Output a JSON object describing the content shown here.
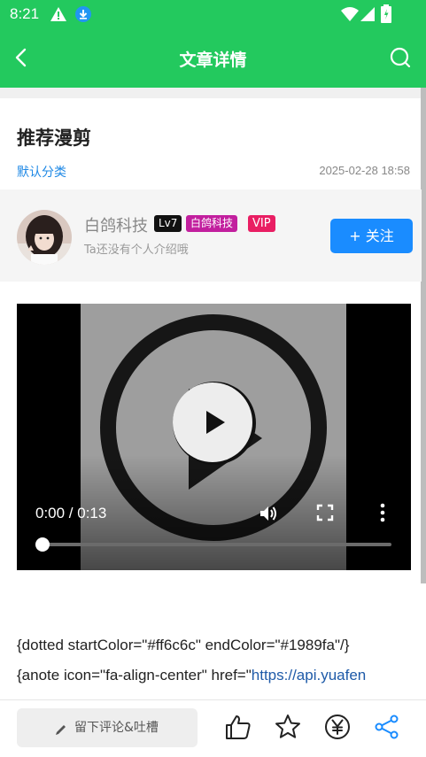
{
  "status_bar": {
    "time": "8:21"
  },
  "app_bar": {
    "title": "文章详情"
  },
  "article": {
    "title": "推荐漫剪",
    "category": "默认分类",
    "date": "2025-02-28 18:58"
  },
  "author": {
    "name": "白鸽科技",
    "level_badge": "Lv7",
    "org_badge": "白鸽科技",
    "vip_badge": "VIP",
    "bio": "Ta还没有个人介绍哦",
    "follow_label": "+ 关注"
  },
  "video": {
    "current_time": "0:00",
    "duration": "0:13",
    "time_display": "0:00 / 0:13",
    "progress": 0
  },
  "content": {
    "line1": "{dotted startColor=\"#ff6c6c\" endColor=\"#1989fa\"/}",
    "line2_prefix": "{anote icon=\"fa-align-center\" href=\"",
    "line2_link": "https://api.yuafen"
  },
  "bottom_bar": {
    "comment_placeholder": "留下评论&吐槽"
  },
  "colors": {
    "accent": "#23c95e",
    "link": "#1e88e5",
    "follow": "#1a8cff"
  }
}
